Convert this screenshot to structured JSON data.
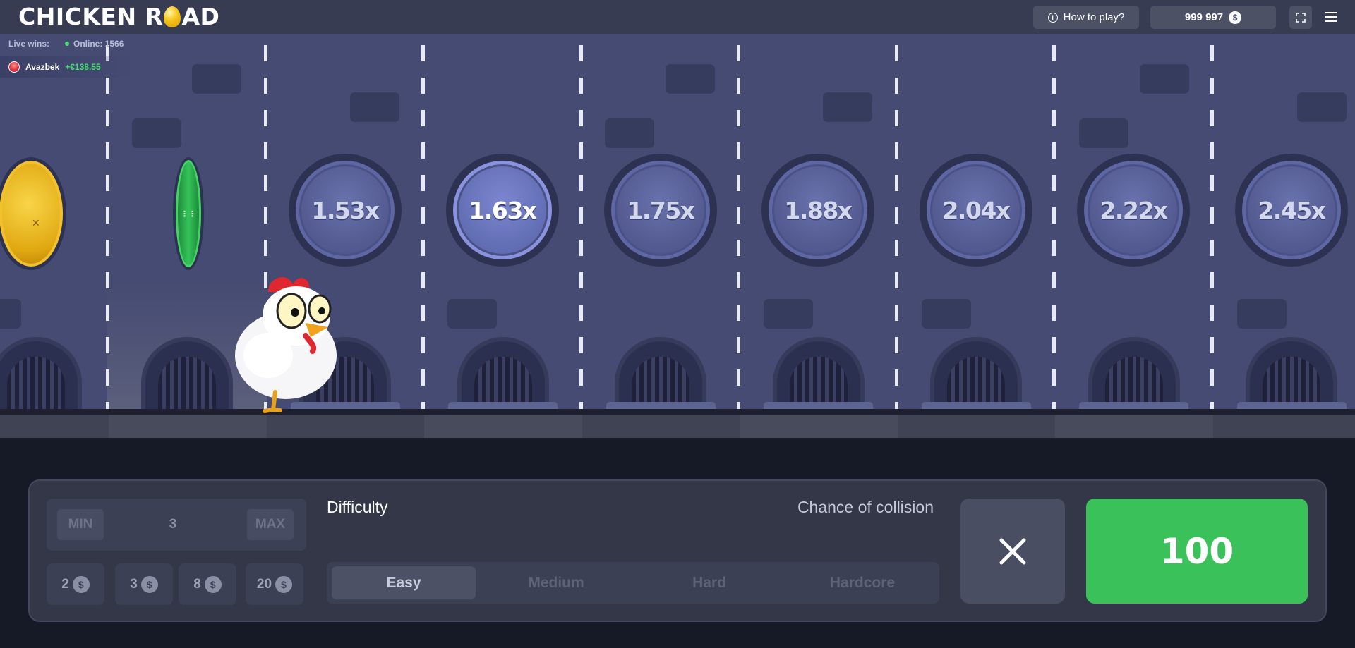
{
  "header": {
    "logo_left": "CHICKEN R",
    "logo_right": "AD",
    "how_to_play": "How to play?",
    "balance": "999 997",
    "currency_symbol": "$"
  },
  "live": {
    "label": "Live wins:",
    "online": "Online: 1566",
    "recent": {
      "name": "Avazbek",
      "amount": "+€138.55"
    }
  },
  "multipliers": [
    "1.53x",
    "1.63x",
    "1.75x",
    "1.88x",
    "2.04x",
    "2.22x",
    "2.45x"
  ],
  "active_multiplier_index": 1,
  "bet": {
    "min_label": "MIN",
    "max_label": "MAX",
    "value": "3",
    "chips": [
      "2",
      "3",
      "8",
      "20"
    ],
    "chip_symbol": "$"
  },
  "difficulty": {
    "title": "Difficulty",
    "chance_label": "Chance of collision",
    "options": [
      "Easy",
      "Medium",
      "Hard",
      "Hardcore"
    ],
    "selected": "Easy"
  },
  "actions": {
    "go_label": "100",
    "cancel_icon": "close-icon"
  },
  "colors": {
    "accent_green": "#3ac15a",
    "panel": "#333748",
    "game_bg": "#454b72"
  }
}
